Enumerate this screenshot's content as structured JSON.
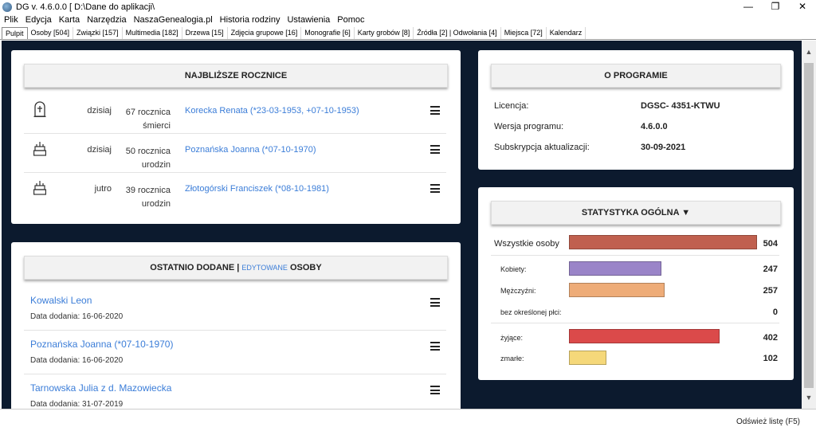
{
  "window": {
    "title": "DG v. 4.6.0.0  [ D:\\Dane do aplikacji\\",
    "controls": {
      "minimize": "—",
      "restore": "❐",
      "close": "✕"
    }
  },
  "menu": [
    "Plik",
    "Edycja",
    "Karta",
    "Narzędzia",
    "NaszaGenealogia.pl",
    "Historia rodziny",
    "Ustawienia",
    "Pomoc"
  ],
  "tabs": [
    "Pulpit",
    "Osoby [504]",
    "Związki [157]",
    "Multimedia [182]",
    "Drzewa [15]",
    "Zdjęcia grupowe [16]",
    "Monografie [6]",
    "Karty grobów [8]",
    "Źródła [2] | Odwołania [4]",
    "Miejsca [72]",
    "Kalendarz"
  ],
  "active_tab": "Pulpit",
  "anniversaries": {
    "title": "NAJBLIŻSZE ROCZNICE",
    "items": [
      {
        "icon": "tombstone-icon",
        "when": "dzisiaj",
        "count_line1": "67 rocznica",
        "count_line2": "śmierci",
        "person": "Korecka Renata (*23-03-1953, +07-10-1953)"
      },
      {
        "icon": "cake-icon",
        "when": "dzisiaj",
        "count_line1": "50 rocznica",
        "count_line2": "urodzin",
        "person": "Poznańska Joanna (*07-10-1970)"
      },
      {
        "icon": "cake-icon",
        "when": "jutro",
        "count_line1": "39 rocznica",
        "count_line2": "urodzin",
        "person": "Złotogórski Franciszek (*08-10-1981)"
      }
    ]
  },
  "recent": {
    "title_pre": "OSTATNIO DODANE |",
    "title_edited": "EDYTOWANE",
    "title_post": "OSOBY",
    "items": [
      {
        "name": "Kowalski Leon",
        "added": "Data dodania: 16-06-2020"
      },
      {
        "name": "Poznańska Joanna (*07-10-1970)",
        "added": "Data dodania: 16-06-2020"
      },
      {
        "name": "Tarnowska Julia z d. Mazowiecka",
        "added": "Data dodania: 31-07-2019"
      }
    ]
  },
  "program": {
    "title": "O PROGRAMIE",
    "rows": [
      {
        "label": "Licencja:",
        "value": "DGSC- 4351-KTWU"
      },
      {
        "label": "Wersja programu:",
        "value": "4.6.0.0"
      },
      {
        "label": "Subskrypcja aktualizacji:",
        "value": "30-09-2021"
      }
    ]
  },
  "stats": {
    "title": "STATYSTYKA OGÓLNA",
    "title_caret": "▼",
    "rows": [
      {
        "label": "Wszystkie osoby",
        "value": "504",
        "fraction": 1.0,
        "color": "#c0604f"
      },
      {
        "label": "Kobiety:",
        "value": "247",
        "fraction": 0.49,
        "color": "#9a84c8"
      },
      {
        "label": "Mężczyźni:",
        "value": "257",
        "fraction": 0.51,
        "color": "#eeac78"
      },
      {
        "label": "bez określonej płci:",
        "value": "0",
        "fraction": 0,
        "color": "#cccccc"
      },
      {
        "label": "żyjące:",
        "value": "402",
        "fraction": 0.8,
        "color": "#db4a4a"
      },
      {
        "label": "zmarłe:",
        "value": "102",
        "fraction": 0.2,
        "color": "#f5d87a"
      }
    ]
  },
  "footer": {
    "refresh": "Odśwież listę (F5)"
  }
}
